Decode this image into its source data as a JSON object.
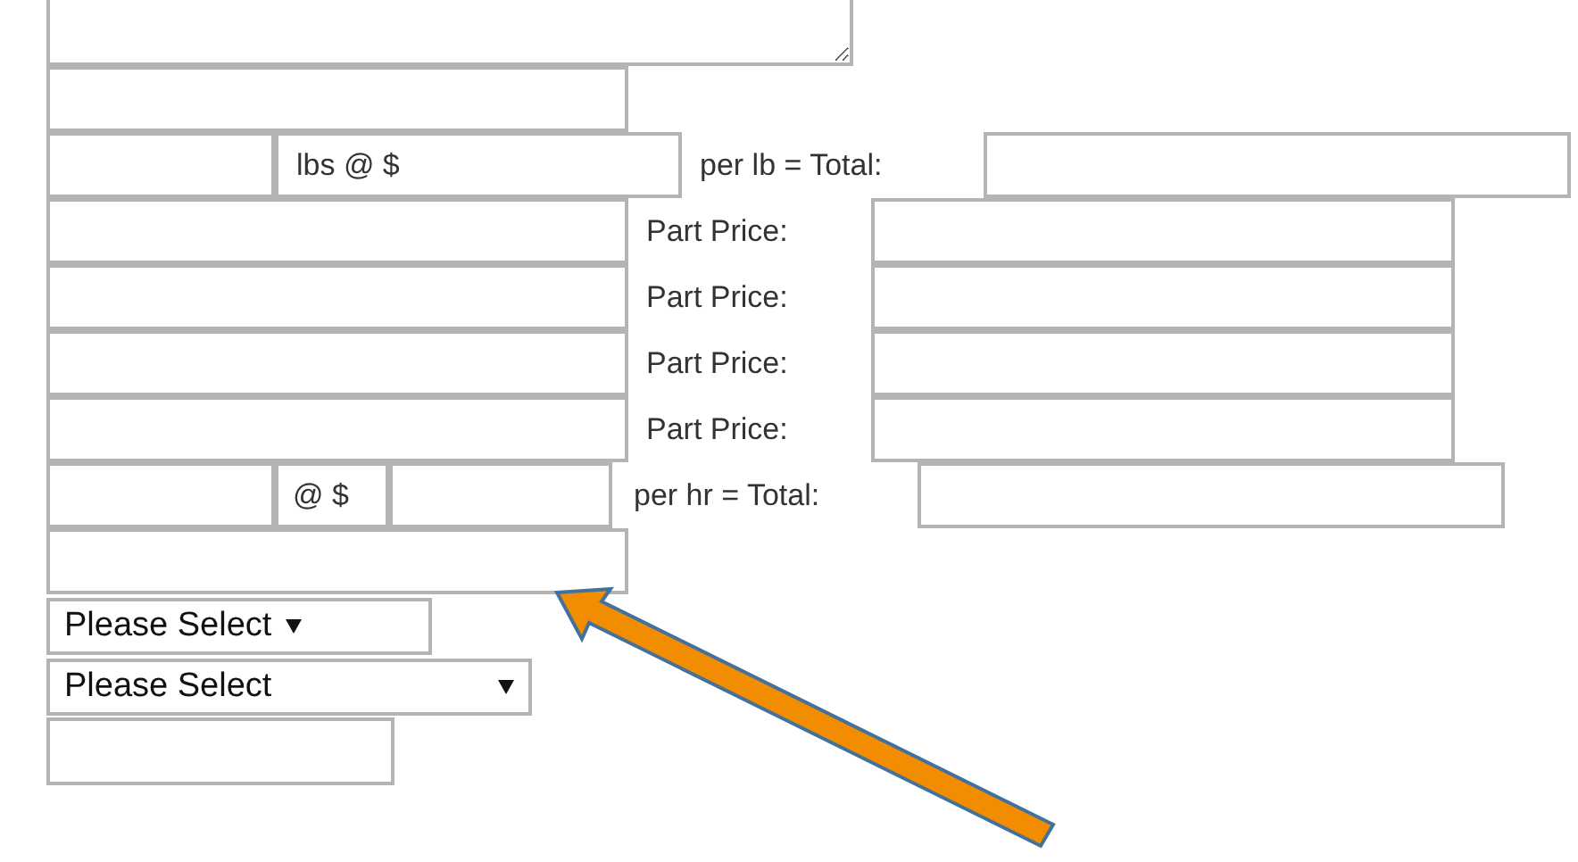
{
  "weight_row": {
    "unit_label": "lbs @ $",
    "total_label": "per lb = Total:"
  },
  "part_rows": [
    {
      "label": "Part Price:"
    },
    {
      "label": "Part Price:"
    },
    {
      "label": "Part Price:"
    },
    {
      "label": "Part Price:"
    }
  ],
  "labor_row": {
    "rate_label": "@ $",
    "total_label": "per hr = Total:"
  },
  "selects": [
    {
      "value": "Please Select"
    },
    {
      "value": "Please Select"
    }
  ]
}
